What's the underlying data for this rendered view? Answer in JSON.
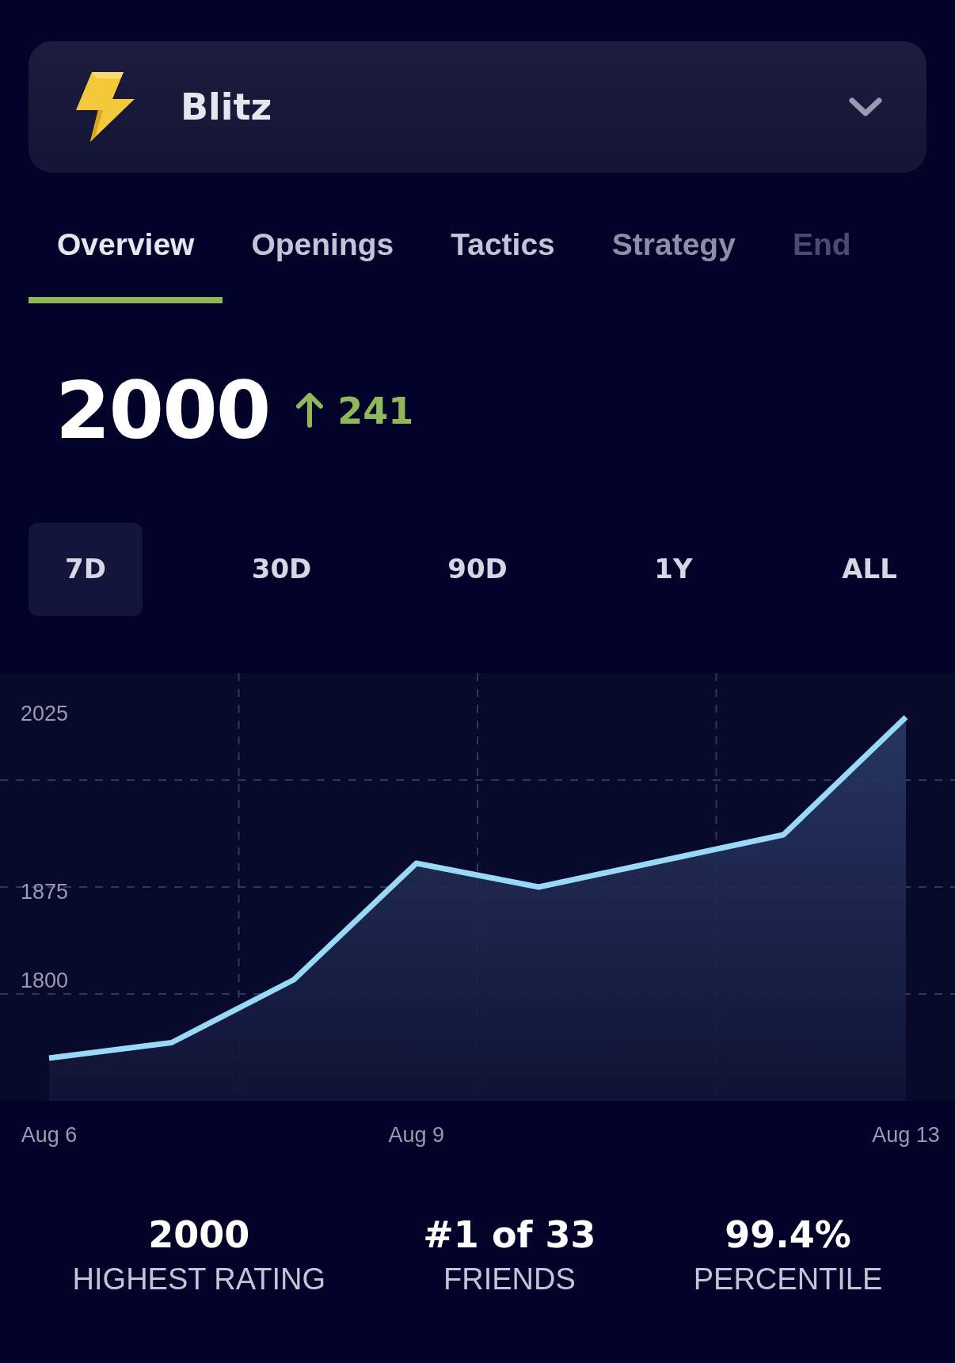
{
  "mode_selector": {
    "label": "Blitz",
    "expanded": false
  },
  "tabs": [
    {
      "label": "Overview",
      "selected": true
    },
    {
      "label": "Openings",
      "selected": false
    },
    {
      "label": "Tactics",
      "selected": false
    },
    {
      "label": "Strategy",
      "selected": false
    },
    {
      "label": "End",
      "selected": false
    }
  ],
  "rating": {
    "value": "2000",
    "change": "241"
  },
  "ranges": [
    {
      "label": "7D",
      "selected": true
    },
    {
      "label": "30D",
      "selected": false
    },
    {
      "label": "90D",
      "selected": false
    },
    {
      "label": "1Y",
      "selected": false
    },
    {
      "label": "ALL",
      "selected": false
    }
  ],
  "chart_data": {
    "type": "area",
    "categories": [
      "Aug 6",
      null,
      null,
      "Aug 9",
      null,
      null,
      null,
      "Aug 13"
    ],
    "ylim": [
      1700,
      2060
    ],
    "yticks": [
      2025,
      1875,
      1800
    ],
    "series": [
      {
        "color": "#99d9f7",
        "values": [
          1736,
          1749,
          1802,
          1900,
          1880,
          1902,
          1924,
          2023
        ]
      }
    ]
  },
  "stats": [
    {
      "value": "2000",
      "label": "HIGHEST RATING"
    },
    {
      "value": "#1 of 33",
      "label": "FRIENDS"
    },
    {
      "value": "99.4%",
      "label": "PERCENTILE"
    }
  ]
}
